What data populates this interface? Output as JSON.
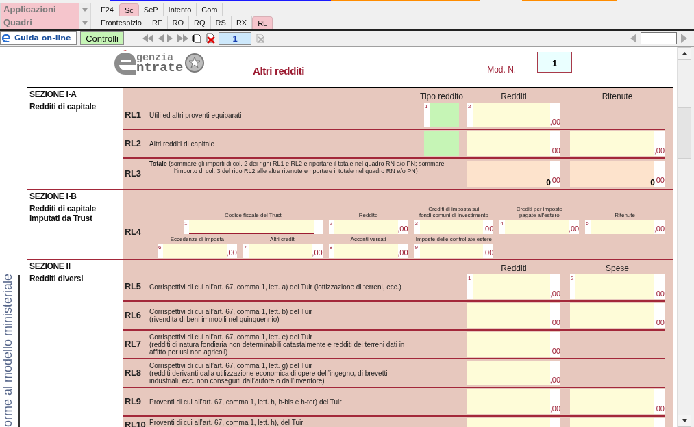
{
  "top_bar": {
    "applications_menu": "Applicazioni",
    "applications_tabs": [
      {
        "label": "F24",
        "selected": false
      },
      {
        "label": "Sc",
        "selected": true
      },
      {
        "label": "SeP",
        "selected": false
      },
      {
        "label": "Intento",
        "selected": false
      },
      {
        "label": "Com",
        "selected": false
      }
    ],
    "frames_menu": "Quadri",
    "frame_tabs": [
      {
        "label": "Frontespizio",
        "selected": false
      },
      {
        "label": "RF",
        "selected": false
      },
      {
        "label": "RO",
        "selected": false
      },
      {
        "label": "RQ",
        "selected": false
      },
      {
        "label": "RS",
        "selected": false
      },
      {
        "label": "RX",
        "selected": false
      },
      {
        "label": "RL",
        "selected": true
      }
    ],
    "help_button": "Guida on-line",
    "checks_button": "Controlli",
    "page_number": "1"
  },
  "header": {
    "logo_lines": [
      "genzia",
      "ntrate"
    ],
    "title": "Altri redditi",
    "model_label": "Mod. N.",
    "model_number": "1"
  },
  "side_label": "orme al modello ministeriale",
  "sections": [
    {
      "title": "SEZIONE I-A",
      "subtitle": "Redditi di capitale",
      "columns": [
        "Tipo reddito",
        "Redditi",
        "Ritenute"
      ],
      "rows": [
        {
          "kind": "line",
          "code": "RL1",
          "text": "Utili ed altri proventi equiparati",
          "cells": [
            {
              "kind": "code",
              "number": "1"
            },
            {
              "kind": "amount",
              "number": "2",
              "suffix": ",00"
            },
            {
              "kind": "empty"
            }
          ]
        },
        {
          "kind": "line",
          "code": "RL2",
          "text": "Altri redditi di capitale",
          "cells": [
            {
              "kind": "code"
            },
            {
              "kind": "amount",
              "suffix": "00"
            },
            {
              "kind": "amount",
              "suffix": ",00"
            }
          ]
        },
        {
          "kind": "line",
          "code": "RL3",
          "text": "**Totale** (sommare gli importi di col. 2 dei righi RL1 e RL2 e riportare il totale nel quadro RN e/o PN; sommare l’importo di col. 3 del rigo RL2 alle altre ritenute e riportare il totale nel quadro RN e/o PN)",
          "cells": [
            {
              "kind": "empty"
            },
            {
              "kind": "total",
              "value": "0",
              "suffix": "00"
            },
            {
              "kind": "total",
              "value": "0",
              "suffix": "00"
            }
          ]
        }
      ]
    },
    {
      "title": "SEZIONE I-B",
      "subtitle": "Redditi di capitale imputati da Trust",
      "rows": [
        {
          "kind": "grid",
          "code": "RL4",
          "lines": [
            [
              {
                "kind": "taxcode",
                "label": "Codice fiscale del Trust",
                "number": "1"
              },
              {
                "kind": "amount",
                "label": "Reddito",
                "number": "2",
                "suffix": ",00"
              },
              {
                "kind": "amount",
                "label": "Crediti di imposta sui\nfondi comuni di investimento",
                "number": "3",
                "suffix": ",00"
              },
              {
                "kind": "amount",
                "label": "Crediti per imposte\npagate all’estero",
                "number": "4",
                "suffix": ",00"
              },
              {
                "kind": "amount",
                "label": "Ritenute",
                "number": "5",
                "suffix": ",00"
              }
            ],
            [
              {
                "kind": "amount",
                "label": "Eccedenze di imposta",
                "number": "6",
                "suffix": ",00"
              },
              {
                "kind": "amount",
                "label": "Altri crediti",
                "number": "7",
                "suffix": ",00"
              },
              {
                "kind": "amount",
                "label": "Acconti versati",
                "number": "8",
                "suffix": ",00"
              },
              {
                "kind": "amount",
                "label": "Imposte delle controllate estere",
                "number": "9",
                "suffix": ",00"
              }
            ]
          ]
        }
      ]
    },
    {
      "title": "SEZIONE II",
      "subtitle": "Redditi diversi",
      "columns": [
        "Redditi",
        "Spese"
      ],
      "rows": [
        {
          "kind": "line",
          "code": "RL5",
          "text": "Corrispettivi di cui all’art. 67, comma 1, lett. a) del Tuir (lottizzazione di terreni, ecc.)",
          "cells": [
            {
              "kind": "amount",
              "number": "1",
              "suffix": ",00"
            },
            {
              "kind": "amount",
              "number": "2",
              "suffix": "00"
            }
          ]
        },
        {
          "kind": "line",
          "code": "RL6",
          "text": "Corrispettivi di cui all’art. 67, comma 1, lett. b) del Tuir\n(rivendita di beni immobili nel quinquennio)",
          "cells": [
            {
              "kind": "amount",
              "suffix": "00"
            },
            {
              "kind": "amount",
              "suffix": "00"
            }
          ]
        },
        {
          "kind": "line",
          "code": "RL7",
          "text": "Corrispettivi di cui all’art. 67, comma 1, lett. e) del Tuir\n(redditi di natura fondiaria non determinabili catastalmente e redditi dei terreni dati in\naffitto per usi non agricoli)",
          "cells": [
            {
              "kind": "amount",
              "suffix": "00"
            },
            {
              "kind": "empty"
            }
          ]
        },
        {
          "kind": "line",
          "code": "RL8",
          "text": "Corrispettivi di cui all’art. 67, comma 1, lett. g) del Tuir\n(redditi derivanti dalla utilizzazione economica di opere dell’ingegno, di brevetti\nindustriali, ecc. non conseguiti dall’autore o dall’inventore)",
          "cells": [
            {
              "kind": "amount",
              "suffix": ",00"
            },
            {
              "kind": "empty"
            }
          ]
        },
        {
          "kind": "line",
          "code": "RL9",
          "text": "Proventi di cui all’art. 67, comma 1, lett. h, h-bis e h-ter) del Tuir",
          "cells": [
            {
              "kind": "amount",
              "suffix": ",00"
            },
            {
              "kind": "amount",
              "suffix": "00"
            }
          ]
        },
        {
          "kind": "line",
          "code": "RL10",
          "text": "Proventi di cui all’art. 67, comma 1, lett. h), del Tuir",
          "cells": [
            {
              "kind": "amount"
            },
            {
              "kind": "amount"
            }
          ]
        }
      ]
    }
  ]
}
